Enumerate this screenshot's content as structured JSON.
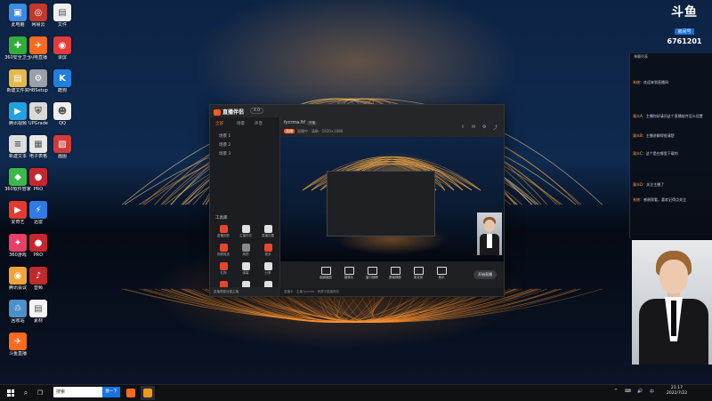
{
  "desktop": {
    "icons": [
      {
        "label": "此电脑",
        "color": "#3b8be0",
        "glyph": "▣",
        "icon": "computer-icon"
      },
      {
        "label": "360安全卫士",
        "color": "#2fae3c",
        "glyph": "✚",
        "icon": "shield-icon"
      },
      {
        "label": "新建文件夹",
        "color": "#e6b84a",
        "glyph": "▤",
        "icon": "folder-icon"
      },
      {
        "label": "腾讯视频",
        "color": "#1fa2e0",
        "glyph": "▶",
        "icon": "video-icon"
      },
      {
        "label": "新建文本",
        "color": "#dddddd",
        "glyph": "≡",
        "icon": "document-icon"
      },
      {
        "label": "360软件管家",
        "color": "#3cb84b",
        "glyph": "◆",
        "icon": "app-icon"
      },
      {
        "label": "爱奇艺",
        "color": "#e23b2f",
        "glyph": "▶",
        "icon": "video-icon"
      },
      {
        "label": "360游戏",
        "color": "#ea3f6a",
        "glyph": "✦",
        "icon": "game-icon"
      },
      {
        "label": "腾讯会议",
        "color": "#f2a33a",
        "glyph": "◉",
        "icon": "meeting-icon"
      },
      {
        "label": "回收站",
        "color": "#4a90c9",
        "glyph": "♲",
        "icon": "recycle-bin-icon"
      },
      {
        "label": "斗鱼直播",
        "color": "#ff6a1f",
        "glyph": "✈",
        "icon": "live-icon"
      },
      {
        "label": "网易云",
        "color": "#c0392b",
        "glyph": "◎",
        "icon": "music-icon"
      },
      {
        "label": "闪电直播",
        "color": "#f46b20",
        "glyph": "✈",
        "icon": "live-icon"
      },
      {
        "label": "HBSetup",
        "color": "#9aa0a8",
        "glyph": "⚙",
        "icon": "setup-icon"
      },
      {
        "label": "UPGrade",
        "color": "#d9d9d9",
        "glyph": "⛨",
        "icon": "shield-icon"
      },
      {
        "label": "电子表格",
        "color": "#e9e9e9",
        "glyph": "▦",
        "icon": "spreadsheet-icon"
      },
      {
        "label": "PRO",
        "color": "#c8262f",
        "glyph": "●",
        "icon": "app-icon"
      },
      {
        "label": "迅雷",
        "color": "#2f7be6",
        "glyph": "⚡",
        "icon": "download-icon"
      },
      {
        "label": "PRO",
        "color": "#c8262f",
        "glyph": "●",
        "icon": "app-icon"
      },
      {
        "label": "音频",
        "color": "#bf2a2a",
        "glyph": "♪",
        "icon": "audio-icon"
      },
      {
        "label": "素材",
        "color": "#f4f4f4",
        "glyph": "▤",
        "icon": "document-icon"
      },
      {
        "label": "文件",
        "color": "#f0f0f0",
        "glyph": "▤",
        "icon": "document-icon"
      },
      {
        "label": "录屏",
        "color": "#e13c3c",
        "glyph": "◉",
        "icon": "record-icon"
      },
      {
        "label": "酷狗",
        "color": "#1f7fe0",
        "glyph": "K",
        "icon": "music-icon"
      },
      {
        "label": "QQ",
        "color": "#eeeeee",
        "glyph": "☻",
        "icon": "qq-icon"
      },
      {
        "label": "画图",
        "color": "#d23b3b",
        "glyph": "▨",
        "icon": "paint-icon"
      }
    ]
  },
  "app": {
    "logo_text": "直播伴侣",
    "version": "4.0",
    "window_controls": [
      "—",
      "□",
      "✕"
    ],
    "tabs": [
      "全部",
      "场景",
      "声音"
    ],
    "scenes": [
      "场景 1",
      "场景 2",
      "场景 3"
    ],
    "tools_title": "工具库",
    "tools": [
      {
        "label": "直播回放",
        "color": "#e8452c"
      },
      {
        "label": "主播任务",
        "color": "#e0e0e0"
      },
      {
        "label": "直播设置",
        "color": "#e0e0e0"
      },
      {
        "label": "视频推送",
        "color": "#e8452c"
      },
      {
        "label": "美颜",
        "color": "#8a8a8a"
      },
      {
        "label": "更多",
        "color": "#e8452c"
      },
      {
        "label": "礼物",
        "color": "#e8452c"
      },
      {
        "label": "弹幕",
        "color": "#e0e0e0"
      },
      {
        "label": "分享",
        "color": "#e0e0e0"
      },
      {
        "label": "特效",
        "color": "#e8452c"
      },
      {
        "label": "助手",
        "color": "#e0e0e0"
      },
      {
        "label": "工具",
        "color": "#e0e0e0"
      }
    ],
    "room_name": "fycrma.ltf",
    "room_badge": "开播",
    "stream_tag": "直播",
    "stream_info": "直播中 · 清晰 · 1920×1080",
    "controls": [
      "画面缩放",
      "摄像头",
      "窗口捕获",
      "屏幕捕获",
      "麦克风",
      "音乐"
    ],
    "start_label": "开始直播",
    "footer_left": "直播需要设置主播",
    "footer_right": "直播中 · 主播 fycrma · 请遵守直播规范"
  },
  "panel": {
    "logo_main": "斗鱼",
    "logo_sub": "房间号",
    "room_number": "6761201",
    "header": "弹幕列表",
    "messages": [
      {
        "user": "系统：",
        "text": "欢迎来到直播间"
      },
      {
        "user": "观众A：",
        "text": "主播你好请问这个直播软件怎么设置"
      },
      {
        "user": "观众B：",
        "text": "主播讲解得很清楚"
      },
      {
        "user": "观众C：",
        "text": "这个是在哪里下载的"
      },
      {
        "user": "观众D：",
        "text": "关注主播了"
      },
      {
        "user": "系统：",
        "text": "感谢观看，喜欢记得点关注"
      }
    ]
  },
  "taskbar": {
    "search_placeholder": "搜索",
    "search_button": "搜一下",
    "time": "21:17",
    "date": "2022/7/22",
    "tray": [
      "^",
      "⌨",
      "🔊",
      "中"
    ]
  },
  "colors": {
    "accent": "#ff5a1f",
    "panel_bg": "#1f2023"
  }
}
